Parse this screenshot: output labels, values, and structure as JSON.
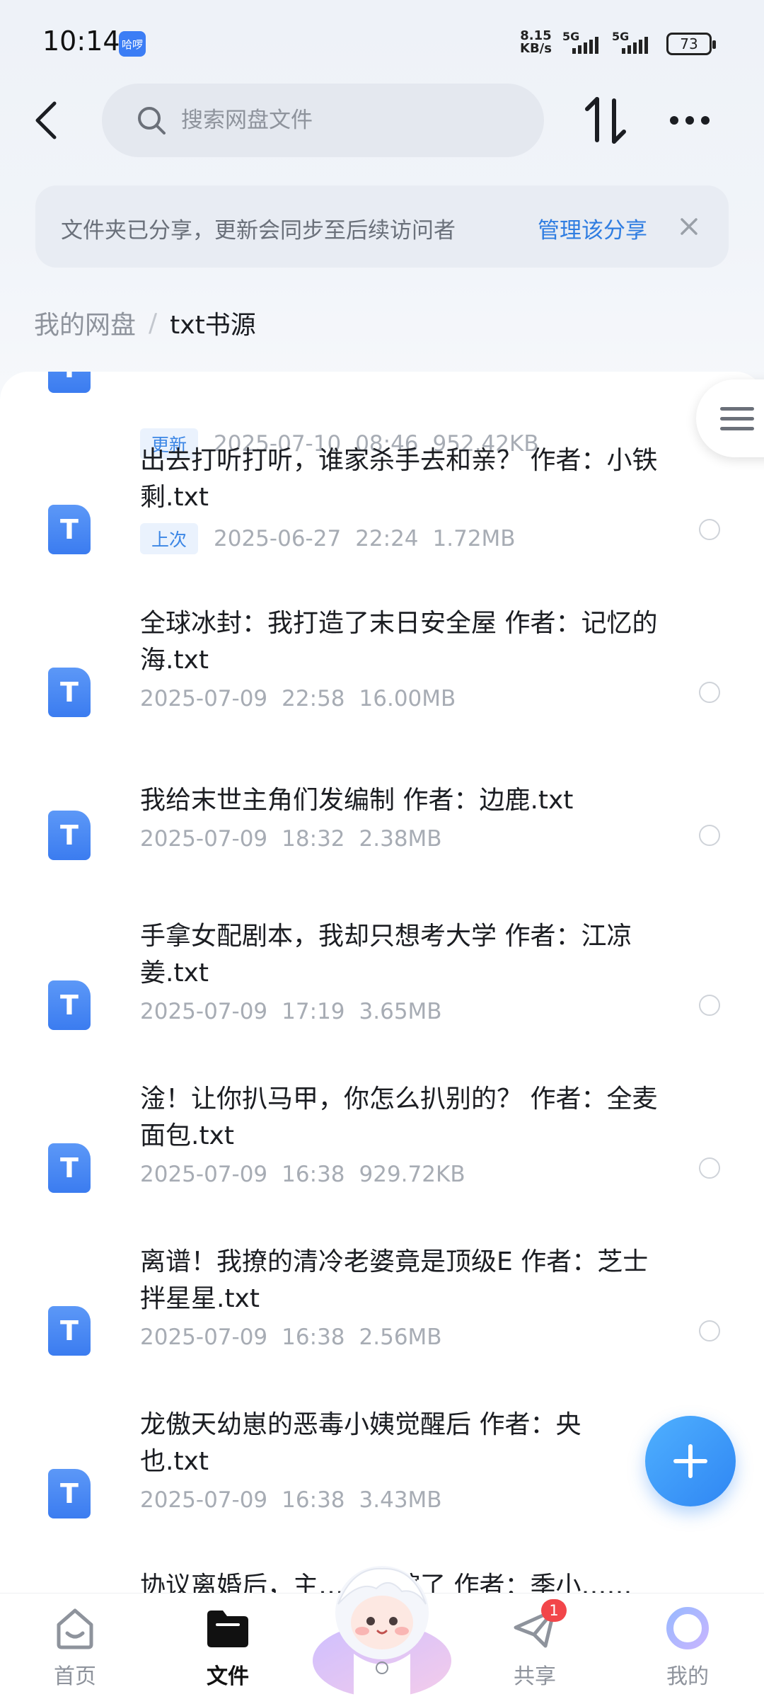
{
  "status_bar": {
    "time": "10:14",
    "app_badge": "哈啰",
    "net_speed_value": "8.15",
    "net_speed_unit": "KB/s",
    "sim1": "5G",
    "sim2": "5G",
    "battery": "73"
  },
  "search": {
    "placeholder": "搜索网盘文件"
  },
  "share_banner": {
    "message": "文件夹已分享，更新会同步至后续访问者",
    "manage_label": "管理该分享"
  },
  "breadcrumb": {
    "root": "我的网盘",
    "separator": "/",
    "current": "txt书源"
  },
  "files": [
    {
      "name": "",
      "tag": "更新",
      "date": "2025-07-10",
      "time": "08:46",
      "size": "952.42KB"
    },
    {
      "name": "出去打听打听，谁家杀手去和亲？ 作者：小铁剩.txt",
      "tag": "上次",
      "date": "2025-06-27",
      "time": "22:24",
      "size": "1.72MB"
    },
    {
      "name": "全球冰封：我打造了末日安全屋 作者：记忆的海.txt",
      "tag": "",
      "date": "2025-07-09",
      "time": "22:58",
      "size": "16.00MB"
    },
    {
      "name": "我给末世主角们发编制 作者：边鹿.txt",
      "tag": "",
      "date": "2025-07-09",
      "time": "18:32",
      "size": "2.38MB"
    },
    {
      "name": "手拿女配剧本，我却只想考大学 作者：江凉姜.txt",
      "tag": "",
      "date": "2025-07-09",
      "time": "17:19",
      "size": "3.65MB"
    },
    {
      "name": "淦！让你扒马甲，你怎么扒别的？ 作者：全麦面包.txt",
      "tag": "",
      "date": "2025-07-09",
      "time": "16:38",
      "size": "929.72KB"
    },
    {
      "name": "离谱！我撩的清冷老婆竟是顶级E 作者：芝士拌星星.txt",
      "tag": "",
      "date": "2025-07-09",
      "time": "16:38",
      "size": "2.56MB"
    },
    {
      "name": "龙傲天幼崽的恶毒小姨觉醒后 作者：央也.txt",
      "tag": "",
      "date": "2025-07-09",
      "time": "16:38",
      "size": "3.43MB"
    },
    {
      "name": "协议离婚后，主……改嫁了 作者：季小……",
      "tag": "",
      "date": "",
      "time": "",
      "size": ""
    }
  ],
  "file_icon_letter": "T",
  "bottom_nav": {
    "home": "首页",
    "files": "文件",
    "share": "共享",
    "share_badge": "1",
    "mine": "我的"
  },
  "colors": {
    "accent": "#2f7de1",
    "file_icon": "#3b7cf0",
    "badge": "#f2464a"
  }
}
